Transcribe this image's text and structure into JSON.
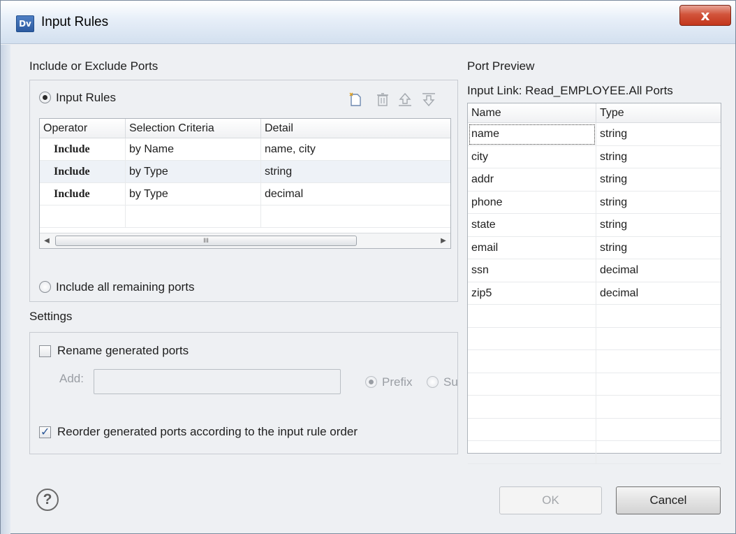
{
  "window": {
    "app_icon": "Dv",
    "title": "Input Rules",
    "close_label": "x"
  },
  "include_exclude": {
    "section_label": "Include or Exclude Ports",
    "input_rules_radio": "Input Rules",
    "input_rules_selected": true,
    "toolbar_icons": [
      "new-rule-icon",
      "delete-icon",
      "move-up-icon",
      "move-down-icon"
    ],
    "columns": [
      "Operator",
      "Selection Criteria",
      "Detail"
    ],
    "rows": [
      {
        "operator": "Include",
        "criteria": "by Name",
        "detail": "name, city"
      },
      {
        "operator": "Include",
        "criteria": "by Type",
        "detail": "string"
      },
      {
        "operator": "Include",
        "criteria": "by Type",
        "detail": "decimal"
      }
    ],
    "scroll_thumb_label": "III",
    "include_remaining_radio": "Include all remaining ports",
    "include_remaining_selected": false
  },
  "settings": {
    "section_label": "Settings",
    "rename_checkbox": "Rename generated ports",
    "rename_checked": false,
    "add_label": "Add:",
    "add_value": "",
    "prefix_label": "Prefix",
    "suffix_label": "Su",
    "prefix_selected": true,
    "reorder_checkbox": "Reorder generated ports according to the input rule order",
    "reorder_checked": true
  },
  "preview": {
    "section_label": "Port Preview",
    "input_link": "Input Link: Read_EMPLOYEE.All Ports",
    "columns": [
      "Name",
      "Type"
    ],
    "rows": [
      {
        "name": "name",
        "type": "string"
      },
      {
        "name": "city",
        "type": "string"
      },
      {
        "name": "addr",
        "type": "string"
      },
      {
        "name": "phone",
        "type": "string"
      },
      {
        "name": "state",
        "type": "string"
      },
      {
        "name": "email",
        "type": "string"
      },
      {
        "name": "ssn",
        "type": "decimal"
      },
      {
        "name": "zip5",
        "type": "decimal"
      }
    ]
  },
  "footer": {
    "help_icon": "?",
    "ok_label": "OK",
    "cancel_label": "Cancel"
  }
}
